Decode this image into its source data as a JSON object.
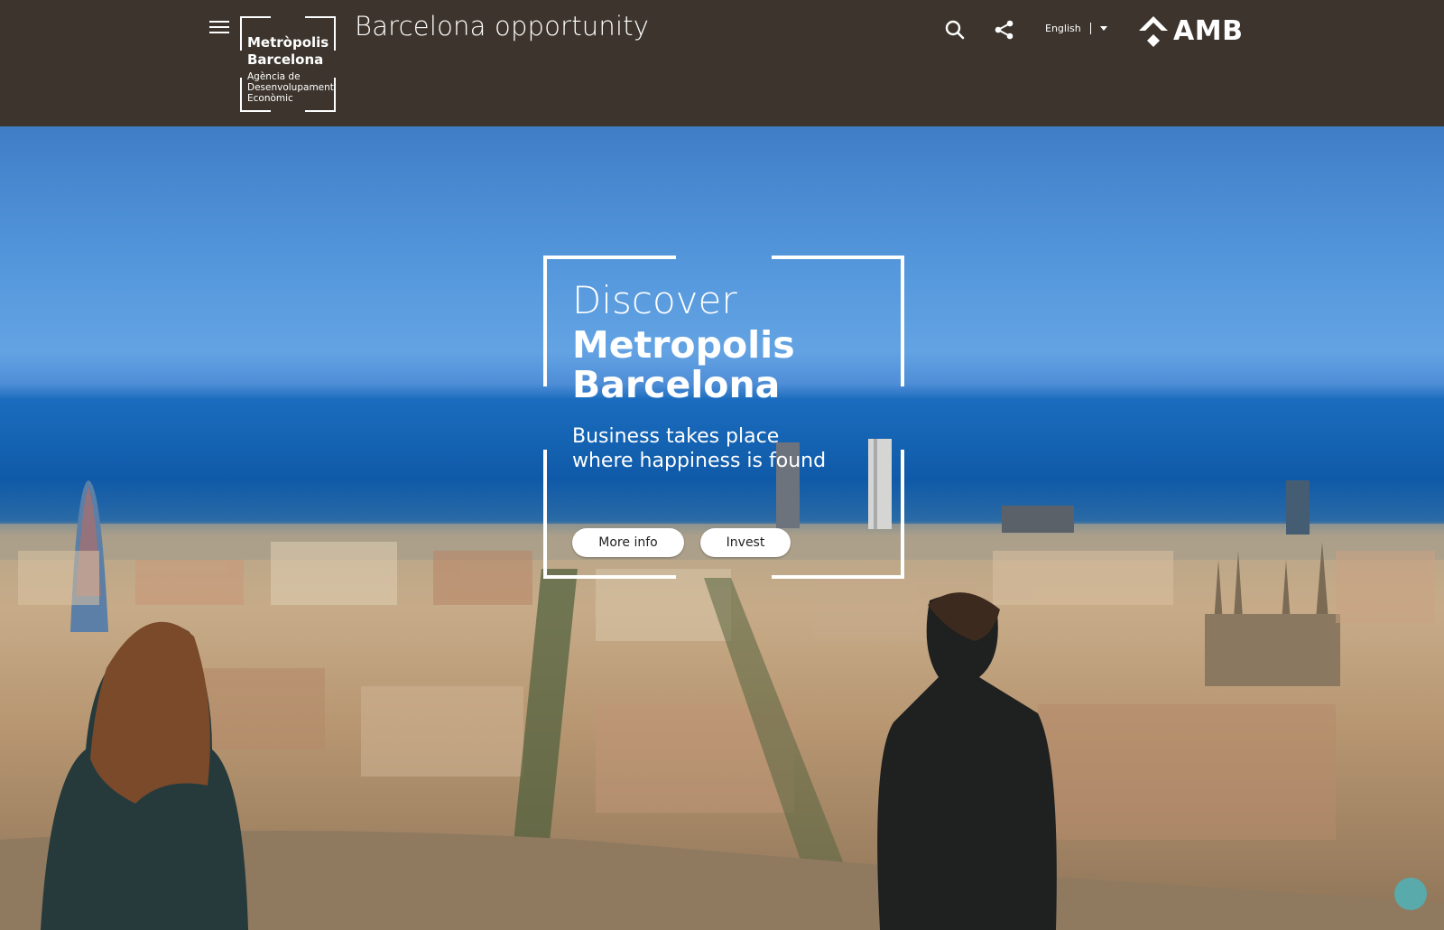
{
  "header": {
    "logo": {
      "line1": "Metròpolis",
      "line2": "Barcelona",
      "line3": "Agència de",
      "line4": "Desenvolupament",
      "line5": "Econòmic"
    },
    "site_title": "Barcelona opportunity",
    "language": "English",
    "brand": "AMB"
  },
  "hero": {
    "heading_light": "Discover",
    "heading_bold_1": "Metropolis",
    "heading_bold_2": "Barcelona",
    "subtitle_line1": "Business takes place",
    "subtitle_line2": "where happiness is found",
    "buttons": {
      "more_info": "More info",
      "invest": "Invest"
    }
  },
  "icons": [
    "menu-icon",
    "search-icon",
    "share-icon",
    "chevron-down-icon",
    "amb-logo-icon"
  ],
  "colors": {
    "header_bg": "#3d352d",
    "accent_white": "#ffffff"
  }
}
